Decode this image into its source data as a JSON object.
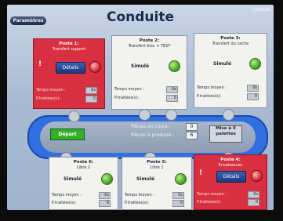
{
  "header": {
    "title": "Conduite",
    "params_label": "Paramètres",
    "date": "13/05/20"
  },
  "postes": [
    {
      "name": "Poste 1:",
      "task": "Transfert support",
      "state": "",
      "details_label": "Détails",
      "alert": "!",
      "temps_label": "Temps moyen :",
      "temps_value": "0s",
      "ptraites_label": "P.traitées(s):",
      "ptraites_value": "0"
    },
    {
      "name": "Poste 2:",
      "task": "Transfert bloc + TEST",
      "state": "Simulé",
      "temps_label": "Temps moyen :",
      "temps_value": "0s",
      "ptraites_label": "P.traitées(s):",
      "ptraites_value": "0"
    },
    {
      "name": "Poste 3:",
      "task": "Transfert du cache",
      "state": "Simulé",
      "temps_label": "Temps moyen :",
      "temps_value": "0s",
      "ptraites_label": "P.traitées(s):",
      "ptraites_value": "0"
    },
    {
      "name": "Poste 4:",
      "task": "Encaisseuse",
      "state": "",
      "details_label": "Détails",
      "alert": "!",
      "temps_label": "Temps moyen :",
      "temps_value": "0s",
      "ptraites_label": "P.traitées(s):",
      "ptraites_value": "0"
    },
    {
      "name": "Poste 5:",
      "task": "Libre 1",
      "state": "Simulé",
      "temps_label": "Temps moyen :",
      "temps_value": "0s",
      "ptraites_label": "P.traitées(s):",
      "ptraites_value": "0"
    },
    {
      "name": "Poste 6:",
      "task": "Libre 2",
      "state": "Simulé",
      "temps_label": "Temps moyen :",
      "temps_value": "0s",
      "ptraites_label": "P.traitées(s):",
      "ptraites_value": "0"
    }
  ],
  "conveyor": {
    "depart_label": "Départ",
    "pieces_en_cours_label": "Pièces en cours :",
    "pieces_en_cours_value": "0",
    "pieces_a_produire_label": "Pièces à produire :",
    "pieces_a_produire_value": "6",
    "mise_line1": "Mise à 0",
    "mise_line2": "palettes"
  },
  "colors": {
    "error": "#d83040",
    "ok": "#3f9a1c",
    "conveyor": "#2f6fe0",
    "start": "#32b02a"
  }
}
